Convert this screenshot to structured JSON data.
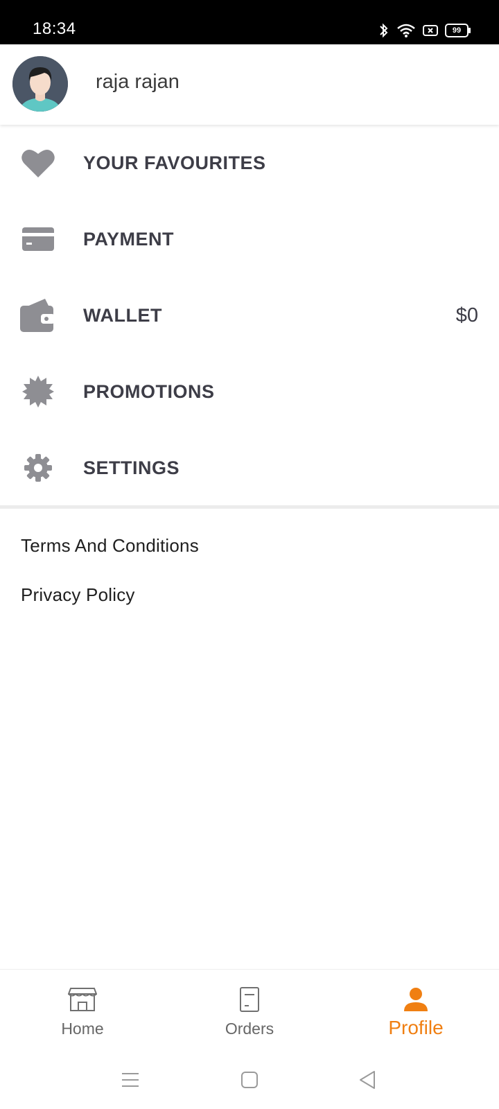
{
  "status_bar": {
    "time": "18:34",
    "battery": "99",
    "icons": [
      "bluetooth-icon",
      "wifi-icon",
      "screen-record-icon",
      "battery-icon"
    ]
  },
  "profile": {
    "name": "raja rajan"
  },
  "menu": {
    "items": [
      {
        "label": "YOUR FAVOURITES",
        "icon": "heart-icon"
      },
      {
        "label": "PAYMENT",
        "icon": "credit-card-icon"
      },
      {
        "label": "WALLET",
        "icon": "wallet-icon",
        "value": "$0"
      },
      {
        "label": "PROMOTIONS",
        "icon": "badge-icon"
      },
      {
        "label": "SETTINGS",
        "icon": "gear-icon"
      }
    ]
  },
  "links": {
    "terms": "Terms And Conditions",
    "privacy": "Privacy Policy"
  },
  "bottom_nav": {
    "items": [
      {
        "label": "Home",
        "icon": "store-icon"
      },
      {
        "label": "Orders",
        "icon": "receipt-icon"
      },
      {
        "label": "Profile",
        "icon": "person-icon",
        "active": true
      }
    ]
  },
  "colors": {
    "accent": "#f07f12",
    "icon_gray": "#8e8e93",
    "text_dark": "#3d3d47"
  }
}
